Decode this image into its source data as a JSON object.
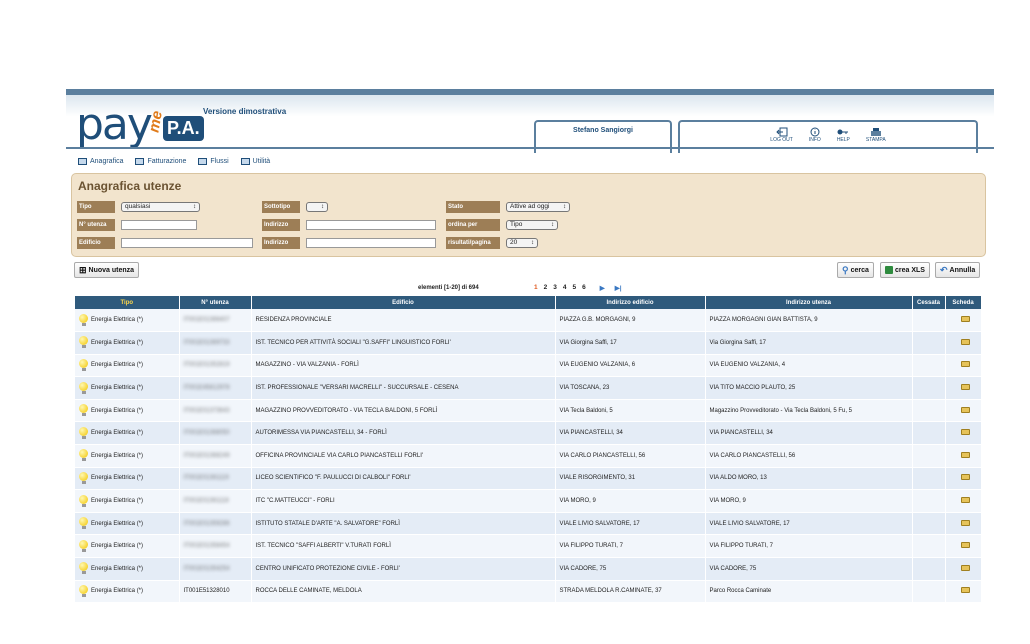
{
  "header": {
    "logo_pay": "pay",
    "logo_me": "me",
    "logo_pa": "P.A.",
    "version": "Versione dimostrativa",
    "user": "Stefano Sangiorgi",
    "tools": [
      "LOG OUT",
      "INFO",
      "HELP",
      "STAMPA"
    ]
  },
  "nav": [
    "Anagrafica",
    "Fatturazione",
    "Flussi",
    "Utilità"
  ],
  "search": {
    "title": "Anagrafica utenze",
    "tipo_label": "Tipo",
    "tipo_value": "qualsiasi",
    "sottotipo_label": "Sottotipo",
    "sottotipo_value": "",
    "stato_label": "Stato",
    "stato_value": "Attive ad oggi",
    "n_utenza_label": "N° utenza",
    "indirizzo_label": "Indirizzo",
    "ordina_label": "ordina per",
    "ordina_value": "Tipo",
    "edificio_label": "Edificio",
    "indirizzo2_label": "Indirizzo",
    "risultati_label": "risultati/pagina",
    "risultati_value": "20"
  },
  "actions": {
    "new": "Nuova utenza",
    "search": "cerca",
    "xls": "crea XLS",
    "cancel": "Annulla"
  },
  "pager": {
    "count": "elementi [1-20] di 694",
    "pages": [
      "1",
      "2",
      "3",
      "4",
      "5",
      "6"
    ]
  },
  "table": {
    "columns": [
      "Tipo",
      "N° utenza",
      "Edificio",
      "Indirizzo edificio",
      "Indirizzo utenza",
      "Cessata",
      "Scheda"
    ],
    "rows": [
      [
        "Energia Elettrica (*)",
        "IT001E01366407",
        "RESIDENZA PROVINCIALE",
        "PIAZZA G.B. MORGAGNI, 9",
        "PIAZZA MORGAGNI GIAN BATTISTA, 9"
      ],
      [
        "Energia Elettrica (*)",
        "IT001E01369733",
        "IST. TECNICO PER ATTIVITÀ SOCIALI \"G.SAFFI\" LINGUISTICO FORLI'",
        "VIA Giorgina Saffi, 17",
        "Via Giorgina Saffi, 17"
      ],
      [
        "Energia Elettrica (*)",
        "IT001E01352819",
        "MAGAZZINO - VIA VALZANIA - FORLÌ",
        "VIA EUGENIO VALZANIA, 6",
        "VIA EUGENIO VALZANIA, 4"
      ],
      [
        "Energia Elettrica (*)",
        "IT001E45812978",
        "IST. PROFESSIONALE \"VERSARI MACRELLI\" - SUCCURSALE - CESENA",
        "VIA TOSCANA, 23",
        "VIA TITO MACCIO PLAUTO, 25"
      ],
      [
        "Energia Elettrica (*)",
        "IT001E01373643",
        "MAGAZZINO PROVVEDITORATO - VIA TECLA BALDONI, 5 FORLÌ",
        "VIA Tecla Baldoni, 5",
        "Magazzino Provveditorato - Via Tecla Baldoni, 5 Fu, 5"
      ],
      [
        "Energia Elettrica (*)",
        "IT001E01368050",
        "AUTORIMESSA VIA PIANCASTELLI, 34 - FORLÌ",
        "VIA PIANCASTELLI, 34",
        "VIA PIANCASTELLI, 34"
      ],
      [
        "Energia Elettrica (*)",
        "IT001E01368249",
        "OFFICINA PROVINCIALE VIA CARLO PIANCASTELLI FORLI'",
        "VIA CARLO PIANCASTELLI, 56",
        "VIA CARLO PIANCASTELLI, 56"
      ],
      [
        "Energia Elettrica (*)",
        "IT001E01361119",
        "LICEO SCIENTIFICO \"F. PAULUCCI DI CALBOLI\" FORLI'",
        "VIALE RISORGIMENTO, 31",
        "VIA ALDO MORO, 13"
      ],
      [
        "Energia Elettrica (*)",
        "IT001E01361118",
        "ITC \"C.MATTEUCCI\" - FORLI",
        "VIA MORO, 9",
        "VIA MORO, 9"
      ],
      [
        "Energia Elettrica (*)",
        "IT001E01359286",
        "ISTITUTO STATALE D'ARTE \"A. SALVATORE\" FORLÌ",
        "VIALE LIVIO SALVATORE, 17",
        "VIALE LIVIO SALVATORE, 17"
      ],
      [
        "Energia Elettrica (*)",
        "IT001E01358454",
        "IST. TECNICO \"SAFFI ALBERTI\" V.TURATI FORLÌ",
        "VIA FILIPPO TURATI, 7",
        "VIA FILIPPO TURATI, 7"
      ],
      [
        "Energia Elettrica (*)",
        "IT001E01354254",
        "CENTRO UNIFICATO PROTEZIONE CIVILE - FORLI'",
        "VIA CADORE, 75",
        "VIA CADORE, 75"
      ],
      [
        "Energia Elettrica (*)",
        "IT001E51328010",
        "ROCCA DELLE CAMINATE, MELDOLA",
        "STRADA MELDOLA R.CAMINATE, 37",
        "Parco Rocca Caminate"
      ]
    ]
  }
}
